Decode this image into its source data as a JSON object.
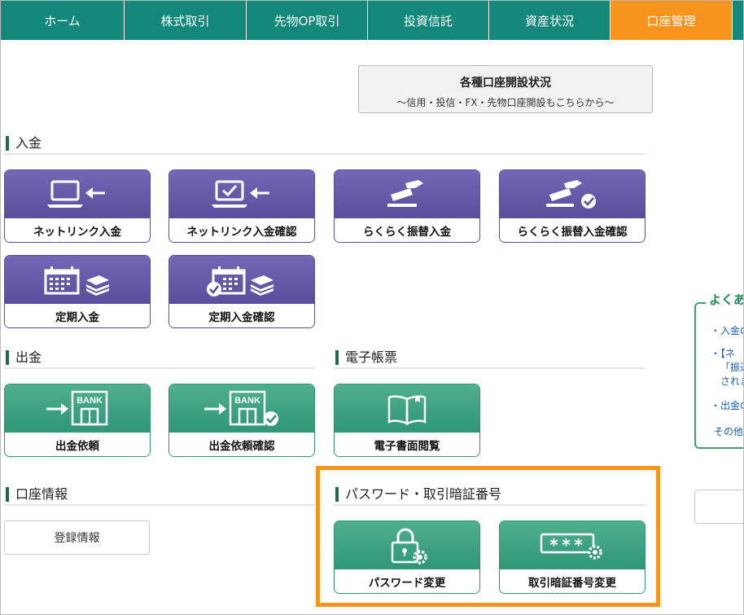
{
  "nav": {
    "items": [
      {
        "label": "ホーム"
      },
      {
        "label": "株式取引"
      },
      {
        "label": "先物OP取引"
      },
      {
        "label": "投資信託"
      },
      {
        "label": "資産状況"
      },
      {
        "label": "口座管理"
      }
    ],
    "active_index": 5
  },
  "status_button": {
    "title": "各種口座開設状況",
    "subtitle": "〜信用・投信・FX・先物口座開設もこちらから〜"
  },
  "sections": {
    "deposit": "入金",
    "withdrawal": "出金",
    "e_docs": "電子帳票",
    "account_info": "口座情報",
    "password": "パスワード・取引暗証番号"
  },
  "deposit_tiles": [
    {
      "label": "ネットリンク入金",
      "icon": "laptop-arrow-icon"
    },
    {
      "label": "ネットリンク入金確認",
      "icon": "laptop-check-arrow-icon"
    },
    {
      "label": "らくらく振替入金",
      "icon": "card-hand-icon"
    },
    {
      "label": "らくらく振替入金確認",
      "icon": "card-hand-check-icon"
    },
    {
      "label": "定期入金",
      "icon": "calendar-coins-icon"
    },
    {
      "label": "定期入金確認",
      "icon": "calendar-coins-check-icon"
    }
  ],
  "withdrawal_tiles": [
    {
      "label": "出金依頼",
      "icon": "bank-arrow-icon"
    },
    {
      "label": "出金依頼確認",
      "icon": "bank-arrow-check-icon"
    }
  ],
  "bank_sign": "BANK",
  "edoc_tile": {
    "label": "電子書面閲覧",
    "icon": "book-icon"
  },
  "account_button": {
    "label": "登録情報"
  },
  "password_tiles": [
    {
      "label": "パスワード変更",
      "icon": "lock-gear-icon"
    },
    {
      "label": "取引暗証番号変更",
      "icon": "masked-code-gear-icon"
    }
  ],
  "masked_code": "***",
  "colors": {
    "nav_bg": "#12877a",
    "nav_active": "#f7941d",
    "purple_tile": "#5a4d9b",
    "green_tile": "#2e9575",
    "highlight": "#f7941d"
  },
  "faq": {
    "title": "よくあ",
    "links": [
      "・入金の",
      "・【ネ",
      "「振込",
      "されま",
      "・出金の",
      "その他"
    ]
  }
}
